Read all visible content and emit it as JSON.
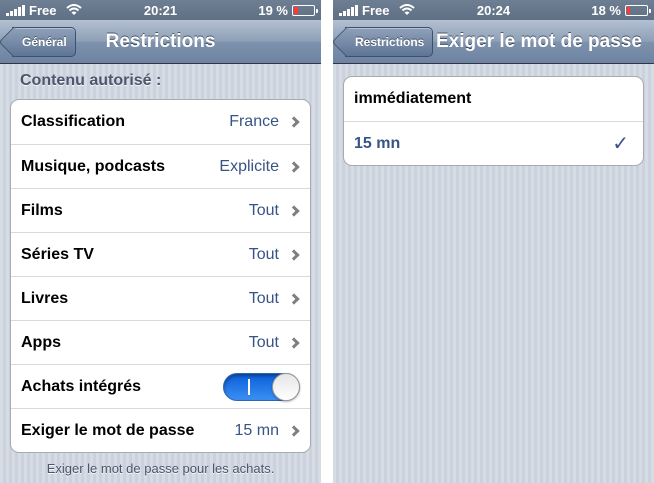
{
  "left": {
    "status": {
      "carrier": "Free",
      "time": "20:21",
      "battery": "19 %",
      "battery_level": 0.19
    },
    "nav": {
      "back_label": "Général",
      "title": "Restrictions"
    },
    "section_header": "Contenu autorisé :",
    "rows": [
      {
        "label": "Classification",
        "value": "France"
      },
      {
        "label": "Musique, podcasts",
        "value": "Explicite"
      },
      {
        "label": "Films",
        "value": "Tout"
      },
      {
        "label": "Séries TV",
        "value": "Tout"
      },
      {
        "label": "Livres",
        "value": "Tout"
      },
      {
        "label": "Apps",
        "value": "Tout"
      }
    ],
    "toggle_row": {
      "label": "Achats intégrés",
      "state": "on"
    },
    "password_row": {
      "label": "Exiger le mot de passe",
      "value": "15 mn"
    },
    "footer": "Exiger le mot de passe pour les achats."
  },
  "right": {
    "status": {
      "carrier": "Free",
      "time": "20:24",
      "battery": "18 %",
      "battery_level": 0.18
    },
    "nav": {
      "back_label": "Restrictions",
      "title": "Exiger le mot de passe"
    },
    "options": [
      {
        "label": "immédiatement",
        "selected": false
      },
      {
        "label": "15 mn",
        "selected": true
      }
    ]
  },
  "colors": {
    "accent_blue": "#385487",
    "toggle_blue": "#1f77e8",
    "battery_low": "#ff3b30"
  },
  "icons": {
    "signal": "signal-bars-icon",
    "wifi": "wifi-icon",
    "battery": "battery-icon",
    "chevron": "chevron-right-icon",
    "check": "checkmark-icon"
  }
}
